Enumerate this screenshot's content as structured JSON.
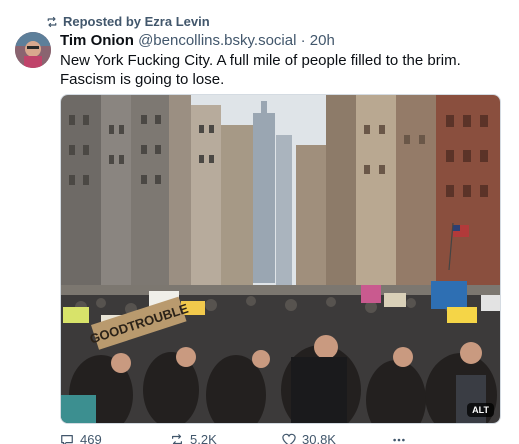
{
  "repost": {
    "label": "Reposted by Ezra Levin",
    "icon": "repost-icon"
  },
  "post": {
    "author_name": "Tim Onion",
    "handle": "@bencollins.bsky.social",
    "separator": "·",
    "time": "20h",
    "text": "New York Fucking City. A full mile of people filled to the brim. Fascism is going to lose.",
    "image": {
      "alt_badge": "ALT",
      "sign_text": "GOODTROUBLE"
    }
  },
  "actions": {
    "reply_count": "469",
    "repost_count": "5.2K",
    "like_count": "30.8K",
    "more_icon": "more-icon"
  },
  "colors": {
    "text": "#0b0f14",
    "muted": "#42576c",
    "sky": "#dfe4e8"
  }
}
